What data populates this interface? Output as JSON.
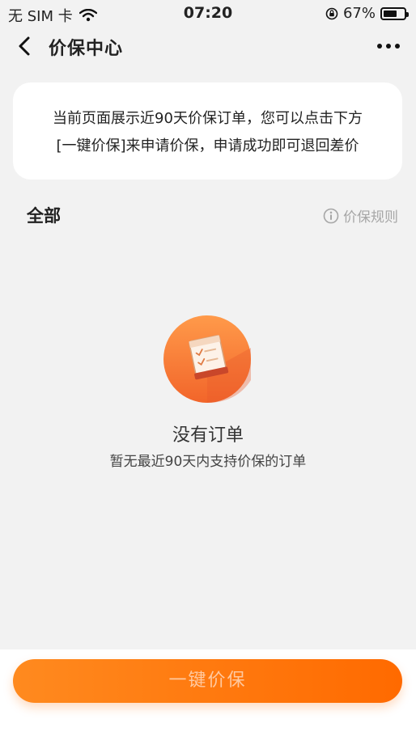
{
  "status_bar": {
    "carrier": "无 SIM 卡",
    "time": "07:20",
    "battery": "67%",
    "battery_level": 0.67
  },
  "nav": {
    "title": "价保中心"
  },
  "notice": {
    "line1": "当前页面展示近90天价保订单，您可以点击下方",
    "line2": "[一键价保]来申请价保，申请成功即可退回差价"
  },
  "filter": {
    "tab_all": "全部",
    "rules_label": "价保规则"
  },
  "empty_state": {
    "title": "没有订单",
    "description": "暂无最近90天内支持价保的订单"
  },
  "actions": {
    "one_click_label": "一键价保"
  },
  "colors": {
    "accent": "#ff7a12",
    "background": "#f2f2f2"
  }
}
